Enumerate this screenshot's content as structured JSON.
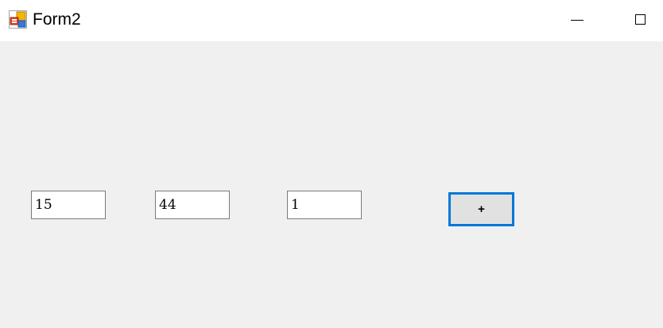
{
  "window": {
    "title": "Form2",
    "app_icon": "windows-form-icon",
    "controls": {
      "minimize_icon": "minimize-icon",
      "maximize_icon": "maximize-icon"
    }
  },
  "form": {
    "textbox1": {
      "value": "15"
    },
    "textbox2": {
      "value": "44"
    },
    "textbox3": {
      "value": "1"
    },
    "add_button_label": "+"
  },
  "colors": {
    "client_background": "#f0f0f0",
    "titlebar_background": "#ffffff",
    "button_focus_border": "#0078d7",
    "button_background": "#e1e1e1",
    "textbox_border": "#7a7a7a"
  }
}
